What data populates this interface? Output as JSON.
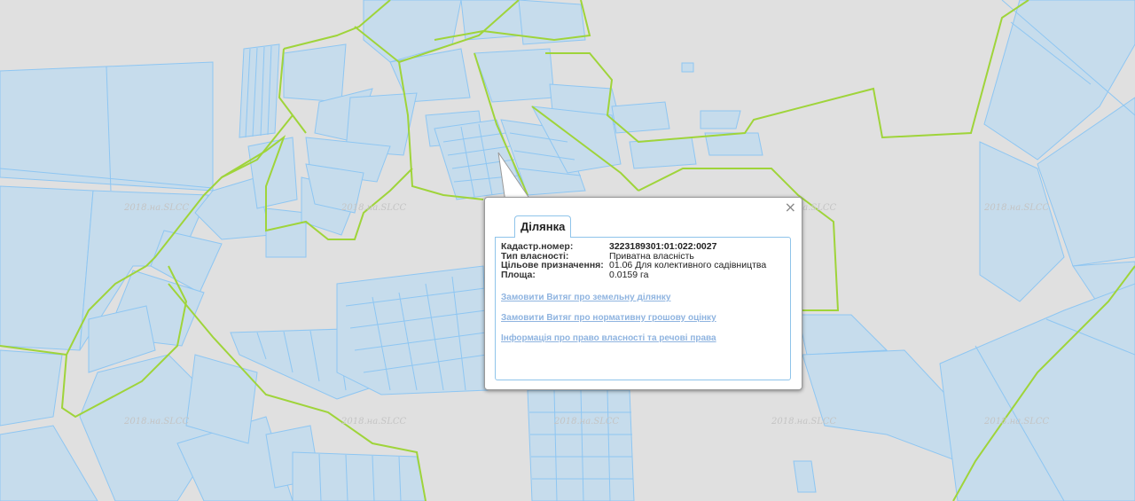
{
  "map": {
    "watermark_text": "2018.на.SLCC",
    "colors": {
      "background": "#e0e0e0",
      "parcel_fill": "#c6dcec",
      "parcel_stroke": "#8ec6f2",
      "boundary": "#9fd43a"
    }
  },
  "popup": {
    "tab_title": "Ділянка",
    "close_icon": "×",
    "fields": [
      {
        "label": "Кадастр.номер:",
        "value": "3223189301:01:022:0027"
      },
      {
        "label": "Тип власності:",
        "value": "Приватна власність"
      },
      {
        "label": "Цільове призначення:",
        "value": "01.06 Для колективного садівництва"
      },
      {
        "label": "Площа:",
        "value": "0.0159 га"
      }
    ],
    "links": [
      "Замовити Витяг про земельну ділянку",
      "Замовити Витяг про нормативну грошову оцінку",
      "Інформація про право власності та речові права"
    ]
  }
}
